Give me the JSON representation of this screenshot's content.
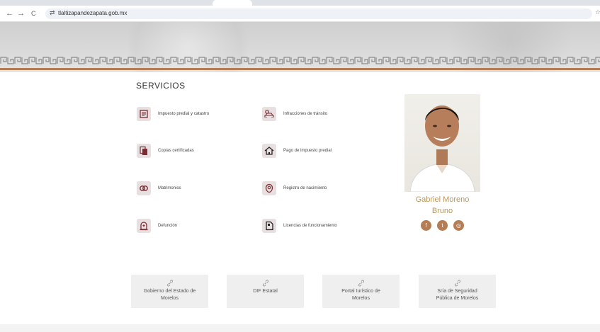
{
  "browser": {
    "url": "tlaltizapandezapata.gob.mx",
    "back_icon": "←",
    "forward_icon": "→",
    "reload_icon": "C",
    "site_info_icon": "⇄",
    "bookmark_icon": "☆"
  },
  "section": {
    "title": "SERVICIOS"
  },
  "services": [
    {
      "label": "Impuesto predial y catastro",
      "icon": "document-icon"
    },
    {
      "label": "Infracciones de tránsito",
      "icon": "car-icon"
    },
    {
      "label": "Copias certificadas",
      "icon": "copy-icon"
    },
    {
      "label": "Pago de impuesto predial",
      "icon": "house-icon"
    },
    {
      "label": "Matrimonios",
      "icon": "rings-icon"
    },
    {
      "label": "Registro de nacimiento",
      "icon": "baby-icon"
    },
    {
      "label": "Defunción",
      "icon": "tombstone-icon"
    },
    {
      "label": "Licencias de funcionamiento",
      "icon": "license-icon"
    }
  ],
  "profile": {
    "name_line1": "Gabriel Moreno",
    "name_line2": "Bruno",
    "social": [
      {
        "name": "facebook-icon",
        "glyph": "f"
      },
      {
        "name": "twitter-icon",
        "glyph": "t"
      },
      {
        "name": "instagram-icon",
        "glyph": "◎"
      }
    ]
  },
  "links": [
    {
      "line1": "Gobierno del Estado de",
      "line2": "Morelos"
    },
    {
      "line1": "DIF Estatal",
      "line2": ""
    },
    {
      "line1": "Portal turístico de",
      "line2": "Morelos"
    },
    {
      "line1": "Sría de Seguridad",
      "line2": "Pública de Morelos"
    }
  ],
  "colors": {
    "accent": "#b57d54",
    "icon_fg": "#7a2d35",
    "name": "#b8975b"
  }
}
